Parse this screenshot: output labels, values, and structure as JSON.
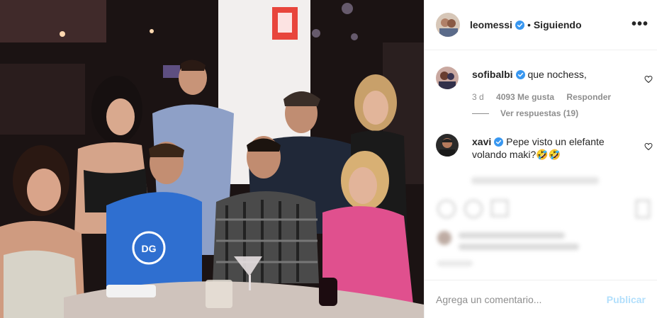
{
  "post": {
    "username": "leomessi",
    "separator": "•",
    "follow_status": "Siguiendo",
    "more_label": "•••"
  },
  "comments": [
    {
      "username": "sofibalbi",
      "text": "que nochess,",
      "age": "3 d",
      "likes": "4093 Me gusta",
      "reply_label": "Responder",
      "view_replies": "Ver respuestas (19)"
    },
    {
      "username": "xavi",
      "text": "Pepe visto un elefante volando maki?🤣🤣",
      "age": "",
      "likes": "",
      "reply_label": ""
    }
  ],
  "composer": {
    "placeholder": "Agrega un comentario...",
    "post_label": "Publicar"
  },
  "colors": {
    "verified": "#3897f0",
    "muted": "#8e8e8e",
    "post_disabled": "#b2dffc",
    "border": "#efefef"
  }
}
